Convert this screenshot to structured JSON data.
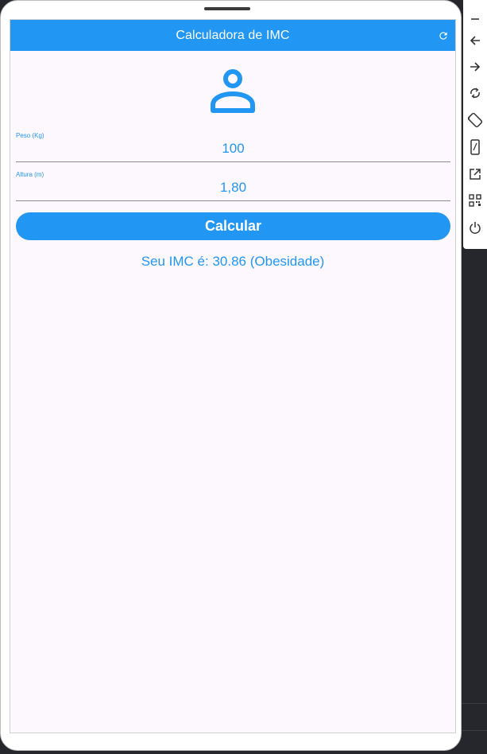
{
  "app": {
    "title": "Calculadora de IMC"
  },
  "icons": {
    "refresh": "refresh-icon",
    "person": "person-icon"
  },
  "form": {
    "weight": {
      "label": "Peso (Kg)",
      "value": "100"
    },
    "height": {
      "label": "Altura (m)",
      "value": "1,80"
    }
  },
  "button": {
    "calculate_label": "Calcular"
  },
  "result": {
    "text": "Seu IMC é: 30.86 (Obesidade)"
  },
  "toolbar": {
    "items": [
      "minimize-icon",
      "back-icon",
      "forward-icon",
      "rotate-icon",
      "rotate-device-icon",
      "phone-icon",
      "open-external-icon",
      "qr-code-icon",
      "power-icon"
    ]
  },
  "colors": {
    "accent": "#2196f3",
    "background": "#fdf8fd"
  }
}
